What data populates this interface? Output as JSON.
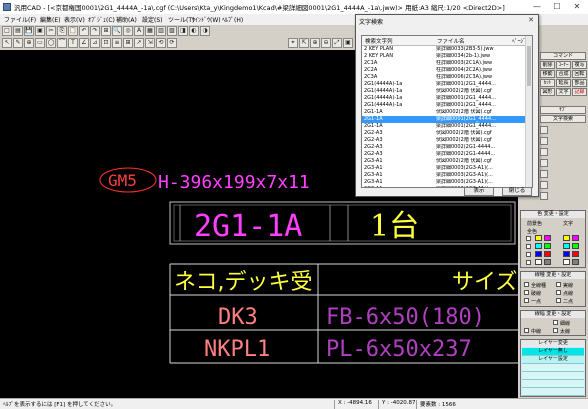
{
  "window": {
    "title": "汎用CAD - [<京都権国0001\\2G1_4444A_-1a\\.cgf (C:\\Users\\Kta_y\\Kingdemo1\\Kcad\\#梁詳細図0001\\2G1_4444A_-1a\\.jww)> 用紙:A3 縮尺:1/20 <Direct2D>]",
    "minimize": "—",
    "maximize": "☐",
    "close": "✕"
  },
  "menu": [
    "ファイル(F)",
    "編集(E)",
    "表示(V)",
    "ｵﾌﾞｼﾞｪ(C)",
    "補助(A)",
    "設定(S)",
    "ツール(T)",
    "ｳｲﾝﾄﾞｳ(W)",
    "ﾍﾙﾌﾟ(H)"
  ],
  "toolbar1": [
    "□",
    "▤",
    "💾",
    "▣",
    "✂",
    "⎘",
    "📋",
    "↶",
    "↷",
    "⊞",
    "🔍",
    "◎",
    "A",
    "▦",
    "▥",
    "▧",
    "◨",
    "◐",
    "◑"
  ],
  "toolbar2": [
    "↖",
    "✎",
    "⊕",
    "▭",
    "◯",
    "⌒",
    "T",
    "∠",
    "⊿",
    "⊡",
    "≡",
    "⊞",
    "↗",
    "⇲",
    "⟲",
    "⟳"
  ],
  "toolbar2_right": [
    "⌖",
    "⇱",
    "⊕",
    "⊖",
    "⤢",
    "▣"
  ],
  "drawing": {
    "mark": "GM5",
    "spec": "H-396x199x7x11",
    "beam_label": "2G1-1A",
    "count": "1台",
    "row_header_left": "ネコ,デッキ受",
    "row_header_right": "サイズ",
    "rows": [
      {
        "name": "DK3",
        "size": "FB-6x50(180)"
      },
      {
        "name": "NKPL1",
        "size": "PL-6x50x237"
      }
    ]
  },
  "dialog": {
    "title": "文字検索",
    "col_text": "検索文字列",
    "col_file": "ファイル名",
    "col_more": "ﾍﾟｰｼﾞ",
    "rows": [
      {
        "text": "2 KEY PLAN",
        "file": "梁詳細0033(2B3-5).jww"
      },
      {
        "text": "2 KEY PLAN",
        "file": "梁詳細0034(2b-1).jww"
      },
      {
        "text": "2C1A",
        "file": "柱詳細0003(2C1A).jww"
      },
      {
        "text": "2C2A",
        "file": "柱詳細0004(2C2A).jww"
      },
      {
        "text": "2C3A",
        "file": "柱詳細0006(2C3A).jww"
      },
      {
        "text": "2G1(4444A)-1a",
        "file": "梁詳細0001(2G1_4444..."
      },
      {
        "text": "2G1(4444A)-1a",
        "file": "伏図0002(2階 伏図).cgf"
      },
      {
        "text": "2G1(4444A)-1a",
        "file": "梁詳細0001(2G1_4444..."
      },
      {
        "text": "2G1(4444A)-1a",
        "file": "梁詳細0001(2G1_4444..."
      },
      {
        "text": "2G1-1A",
        "file": "伏図0002(2階 伏図).cgf"
      },
      {
        "text": "2G1-1A",
        "file": "梁詳細0001(2G1_4444..."
      },
      {
        "text": "2G1-1A",
        "file": "梁詳細0001(2G1_4444..."
      },
      {
        "text": "2G2-A3",
        "file": "伏図0002(2階 伏図).cgf"
      },
      {
        "text": "2G2-A3",
        "file": "伏図0002(2階 伏図).cgf"
      },
      {
        "text": "2G2-A3",
        "file": "梁詳細0002(2G1-4444..."
      },
      {
        "text": "2G2-A3",
        "file": "梁詳細0002(2G1-4444..."
      },
      {
        "text": "2G3-A1",
        "file": "伏図0002(2階 伏図).cgf"
      },
      {
        "text": "2G3-A1",
        "file": "梁詳細0003(2G3-A1)(..."
      },
      {
        "text": "2G3-A1",
        "file": "梁詳細0003(2G3-A1)(..."
      },
      {
        "text": "2G3-A1",
        "file": "梁詳細0003(2G3-A1)(..."
      },
      {
        "text": "2G3-A1",
        "file": "梁詳細0003(2G3-A1)(..."
      }
    ],
    "selected_index": 10,
    "btn_show": "表示",
    "btn_close": "閉じる"
  },
  "right_panel": {
    "cmd_header": "コマンド",
    "cmds": [
      "削除",
      "ｺｰﾅｰ",
      "複写",
      "移動",
      "合成",
      "回転",
      "ｶｯﾄ",
      "延長",
      "部品",
      "図形",
      "文字",
      "記録"
    ],
    "sub_header": "ｻﾌﾞ",
    "sub_items": [
      "文字検索"
    ],
    "color_header": "色 変更・設定",
    "color_labels": [
      "前景色",
      "文字"
    ],
    "color_row": "全色",
    "linetype_header": "線種 変更・設定",
    "linetype_items": [
      "全線種",
      "実線",
      "破線",
      "点線",
      "一点",
      "二点"
    ],
    "linewidth_header": "線幅 変更・設定",
    "linewidth_items": [
      "細線",
      "中線",
      "太線"
    ],
    "layer_header": "レイヤー変更",
    "layer_items": [
      "レイヤー無し",
      "レイヤー設定"
    ],
    "colors": {
      "panel": "#d4d0c8",
      "accent": "#00ffff",
      "highlight": "#3399ff"
    }
  },
  "status": {
    "hint": "ﾍﾙﾌﾟを表示するには [F1] を押してください。",
    "x": "X : -4894.16",
    "y": "Y : -4020.87",
    "count": "要素数 : 1566"
  }
}
